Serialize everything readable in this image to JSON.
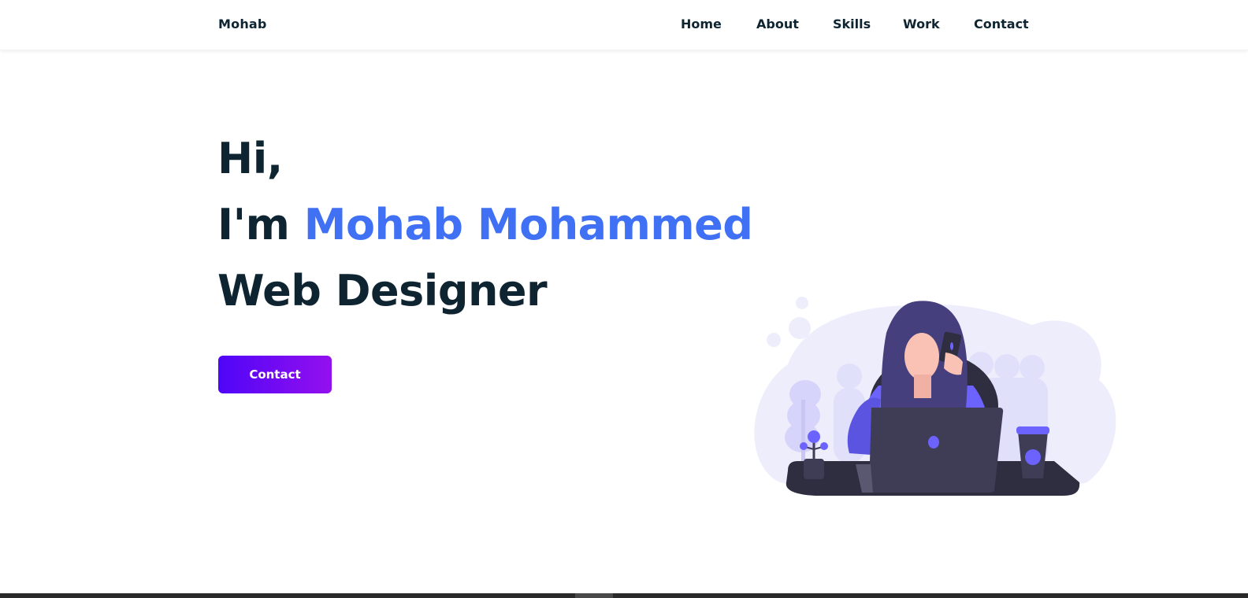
{
  "header": {
    "logo": "Mohab",
    "nav": [
      "Home",
      "About",
      "Skills",
      "Work",
      "Contact"
    ]
  },
  "hero": {
    "greeting": "Hi,",
    "intro_prefix": "I'm ",
    "name": "Mohab Mohammed",
    "role": "Web Designer",
    "button_label": "Contact"
  },
  "colors": {
    "text": "#0e2431",
    "accent": "#4070f4",
    "button_gradient_start": "#4f05f7",
    "button_gradient_end": "#9410ee",
    "illustration_primary": "#6c63ff"
  },
  "icons": {
    "illustration": "woman-on-phone-with-laptop-illustration"
  }
}
